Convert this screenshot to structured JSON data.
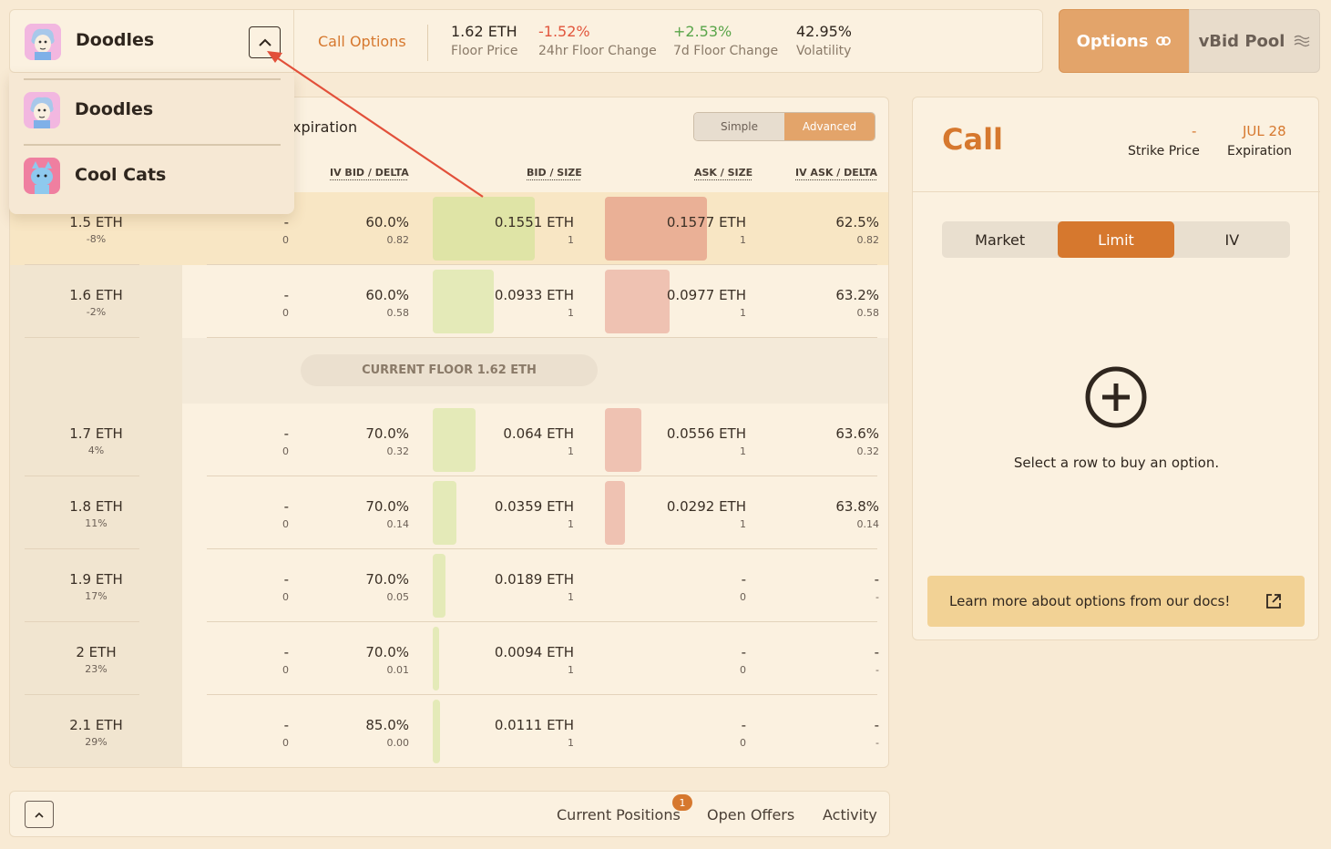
{
  "header": {
    "collection": "Doodles",
    "call_options": "Call Options",
    "stats": [
      {
        "value": "1.62 ETH",
        "label": "Floor Price",
        "color": "#2f261e"
      },
      {
        "value": "-1.52%",
        "label": "24hr Floor Change",
        "color": "#e2563d"
      },
      {
        "value": "+2.53%",
        "label": "7d Floor Change",
        "color": "#5aa54a"
      },
      {
        "value": "42.95%",
        "label": "Volatility",
        "color": "#2f261e"
      }
    ],
    "nav_options": "Options",
    "nav_vbid": "vBid Pool"
  },
  "dropdown": {
    "items": [
      {
        "name": "Doodles",
        "icon": "doodles-avatar"
      },
      {
        "name": "Cool Cats",
        "icon": "cool-cats-avatar"
      }
    ]
  },
  "table": {
    "expiration_label": "xpiration",
    "mode_simple": "Simple",
    "mode_advanced": "Advanced",
    "columns": {
      "iv_bid": "IV BID / DELTA",
      "bid": "BID / SIZE",
      "ask": "ASK / SIZE",
      "iv_ask": "IV ASK / DELTA"
    },
    "current_floor": "CURRENT FLOOR 1.62 ETH",
    "rows": [
      {
        "strike": "1.5 ETH",
        "pct": "-8%",
        "c1": "-",
        "c1b": "0",
        "ivbid": "60.0%",
        "ivbidd": "0.82",
        "bid": "0.1551 ETH",
        "bids": "1",
        "ask": "0.1577 ETH",
        "asks": "1",
        "ivask": "62.5%",
        "ivaskd": "0.82",
        "bidfill": 0.98,
        "askfill": 0.98
      },
      {
        "strike": "1.6 ETH",
        "pct": "-2%",
        "c1": "-",
        "c1b": "0",
        "ivbid": "60.0%",
        "ivbidd": "0.58",
        "bid": "0.0933 ETH",
        "bids": "1",
        "ask": "0.0977 ETH",
        "asks": "1",
        "ivask": "63.2%",
        "ivaskd": "0.58",
        "bidfill": 0.59,
        "askfill": 0.62
      },
      {
        "strike": "1.7 ETH",
        "pct": "4%",
        "c1": "-",
        "c1b": "0",
        "ivbid": "70.0%",
        "ivbidd": "0.32",
        "bid": "0.064 ETH",
        "bids": "1",
        "ask": "0.0556 ETH",
        "asks": "1",
        "ivask": "63.6%",
        "ivaskd": "0.32",
        "bidfill": 0.41,
        "askfill": 0.35
      },
      {
        "strike": "1.8 ETH",
        "pct": "11%",
        "c1": "-",
        "c1b": "0",
        "ivbid": "70.0%",
        "ivbidd": "0.14",
        "bid": "0.0359 ETH",
        "bids": "1",
        "ask": "0.0292 ETH",
        "asks": "1",
        "ivask": "63.8%",
        "ivaskd": "0.14",
        "bidfill": 0.23,
        "askfill": 0.19
      },
      {
        "strike": "1.9 ETH",
        "pct": "17%",
        "c1": "-",
        "c1b": "0",
        "ivbid": "70.0%",
        "ivbidd": "0.05",
        "bid": "0.0189 ETH",
        "bids": "1",
        "ask": "-",
        "asks": "0",
        "ivask": "-",
        "ivaskd": "-",
        "bidfill": 0.12,
        "askfill": 0
      },
      {
        "strike": "2 ETH",
        "pct": "23%",
        "c1": "-",
        "c1b": "0",
        "ivbid": "70.0%",
        "ivbidd": "0.01",
        "bid": "0.0094 ETH",
        "bids": "1",
        "ask": "-",
        "asks": "0",
        "ivask": "-",
        "ivaskd": "-",
        "bidfill": 0.06,
        "askfill": 0
      },
      {
        "strike": "2.1 ETH",
        "pct": "29%",
        "c1": "-",
        "c1b": "0",
        "ivbid": "85.0%",
        "ivbidd": "0.00",
        "bid": "0.0111 ETH",
        "bids": "1",
        "ask": "-",
        "asks": "0",
        "ivask": "-",
        "ivaskd": "-",
        "bidfill": 0.07,
        "askfill": 0
      }
    ]
  },
  "order": {
    "title": "Call",
    "strike_value": "-",
    "strike_label": "Strike Price",
    "exp_value": "JUL 28",
    "exp_label": "Expiration",
    "tabs": [
      "Market",
      "Limit",
      "IV"
    ],
    "hint": "Select a row to buy an option.",
    "docs": "Learn more about options from our docs!"
  },
  "bottom": {
    "tabs": [
      "Current Positions",
      "Open Offers",
      "Activity"
    ],
    "badge": "1"
  }
}
